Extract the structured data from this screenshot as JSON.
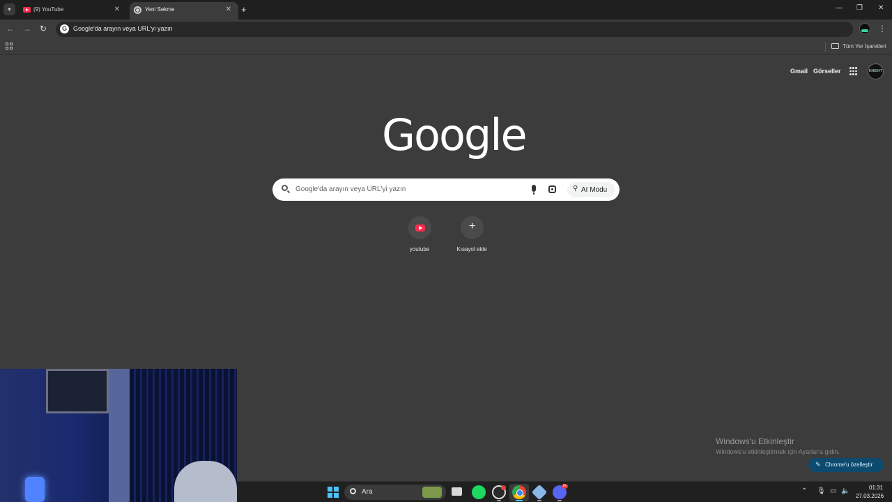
{
  "browser": {
    "tabs": [
      {
        "title": "(9) YouTube",
        "active": false
      },
      {
        "title": "Yeni Sekme",
        "active": true
      }
    ],
    "omnibox": {
      "text": "Google'da arayın veya URL'yi yazın"
    },
    "bookmarks_bar": {
      "all_bookmarks": "Tüm Yer İşaretleri"
    }
  },
  "newtab": {
    "header": {
      "gmail": "Gmail",
      "images": "Görseller",
      "avatar_text": "KNIGHT"
    },
    "logo": "Google",
    "search": {
      "placeholder": "Google'da arayın veya URL'yi yazın",
      "ai_mode": "AI Modu"
    },
    "shortcuts": [
      {
        "label": "youtube"
      },
      {
        "label": "Kısayol ekle"
      }
    ],
    "activation": {
      "title": "Windows'u Etkinleştir",
      "subtitle": "Windows'u etkinleştirmek için Ayarlar'a gidin."
    },
    "customize": "Chrome'u özelleştir"
  },
  "taskbar": {
    "search_label": "Ara",
    "discord_badge": "9+",
    "clock": {
      "time": "01:31",
      "date": "27.03.2026"
    }
  },
  "colors": {
    "accent": "#4cc2ff",
    "page_bg": "#3c3c3c",
    "customize_btn": "#0c4a6e",
    "youtube_red": "#ff2b4f"
  }
}
